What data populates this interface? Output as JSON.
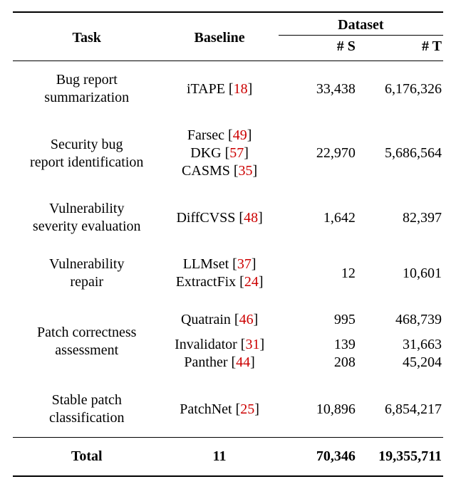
{
  "chart_data": {
    "type": "table",
    "columns": [
      "Task",
      "Baseline",
      "# S",
      "# T"
    ],
    "rows": [
      {
        "task": "Bug report summarization",
        "baselines": [
          "iTAPE [18]"
        ],
        "s": "33,438",
        "t": "6,176,326"
      },
      {
        "task": "Security bug report identification",
        "baselines": [
          "Farsec [49]",
          "DKG [57]",
          "CASMS [35]"
        ],
        "s": "22,970",
        "t": "5,686,564"
      },
      {
        "task": "Vulnerability severity evaluation",
        "baselines": [
          "DiffCVSS [48]"
        ],
        "s": "1,642",
        "t": "82,397"
      },
      {
        "task": "Vulnerability repair",
        "baselines": [
          "LLMset [37]",
          "ExtractFix [24]"
        ],
        "s": "12",
        "t": "10,601"
      },
      {
        "task": "Patch correctness assessment",
        "baselines_rows": [
          {
            "name": "Quatrain [46]",
            "s": "995",
            "t": "468,739"
          },
          {
            "name": "Invalidator [31]",
            "s": "139",
            "t": "31,663"
          },
          {
            "name": "Panther [44]",
            "s": "208",
            "t": "45,204"
          }
        ]
      },
      {
        "task": "Stable patch classification",
        "baselines": [
          "PatchNet [25]"
        ],
        "s": "10,896",
        "t": "6,854,217"
      }
    ],
    "total": {
      "label": "Total",
      "baselines": "11",
      "s": "70,346",
      "t": "19,355,711"
    }
  },
  "header": {
    "task": "Task",
    "baseline": "Baseline",
    "dataset": "Dataset",
    "s": "# S",
    "t": "# T"
  },
  "rows": {
    "r1": {
      "task_l1": "Bug report",
      "task_l2": "summarization",
      "b1": "iTAPE [",
      "b1r": "18",
      "b1c": "]",
      "s": "33,438",
      "t": "6,176,326"
    },
    "r2": {
      "task_l1": "Security bug",
      "task_l2": "report identification",
      "b1": "Farsec [",
      "b1r": "49",
      "b1c": "]",
      "b2": "DKG [",
      "b2r": "57",
      "b2c": "]",
      "b3": "CASMS [",
      "b3r": "35",
      "b3c": "]",
      "s": "22,970",
      "t": "5,686,564"
    },
    "r3": {
      "task_l1": "Vulnerability",
      "task_l2": "severity evaluation",
      "b1": "DiffCVSS [",
      "b1r": "48",
      "b1c": "]",
      "s": "1,642",
      "t": "82,397"
    },
    "r4": {
      "task_l1": "Vulnerability",
      "task_l2": "repair",
      "b1": "LLMset [",
      "b1r": "37",
      "b1c": "]",
      "b2": "ExtractFix [",
      "b2r": "24",
      "b2c": "]",
      "s": "12",
      "t": "10,601"
    },
    "r5": {
      "task_l1": "Patch correctness",
      "task_l2": "assessment",
      "b1": "Quatrain [",
      "b1r": "46",
      "b1c": "]",
      "s1": "995",
      "t1": "468,739",
      "b2": "Invalidator [",
      "b2r": "31",
      "b2c": "]",
      "s2": "139",
      "t2": "31,663",
      "b3": "Panther [",
      "b3r": "44",
      "b3c": "]",
      "s3": "208",
      "t3": "45,204"
    },
    "r6": {
      "task_l1": "Stable patch",
      "task_l2": "classification",
      "b1": "PatchNet [",
      "b1r": "25",
      "b1c": "]",
      "s": "10,896",
      "t": "6,854,217"
    }
  },
  "total": {
    "label": "Total",
    "baseline": "11",
    "s": "70,346",
    "t": "19,355,711"
  }
}
